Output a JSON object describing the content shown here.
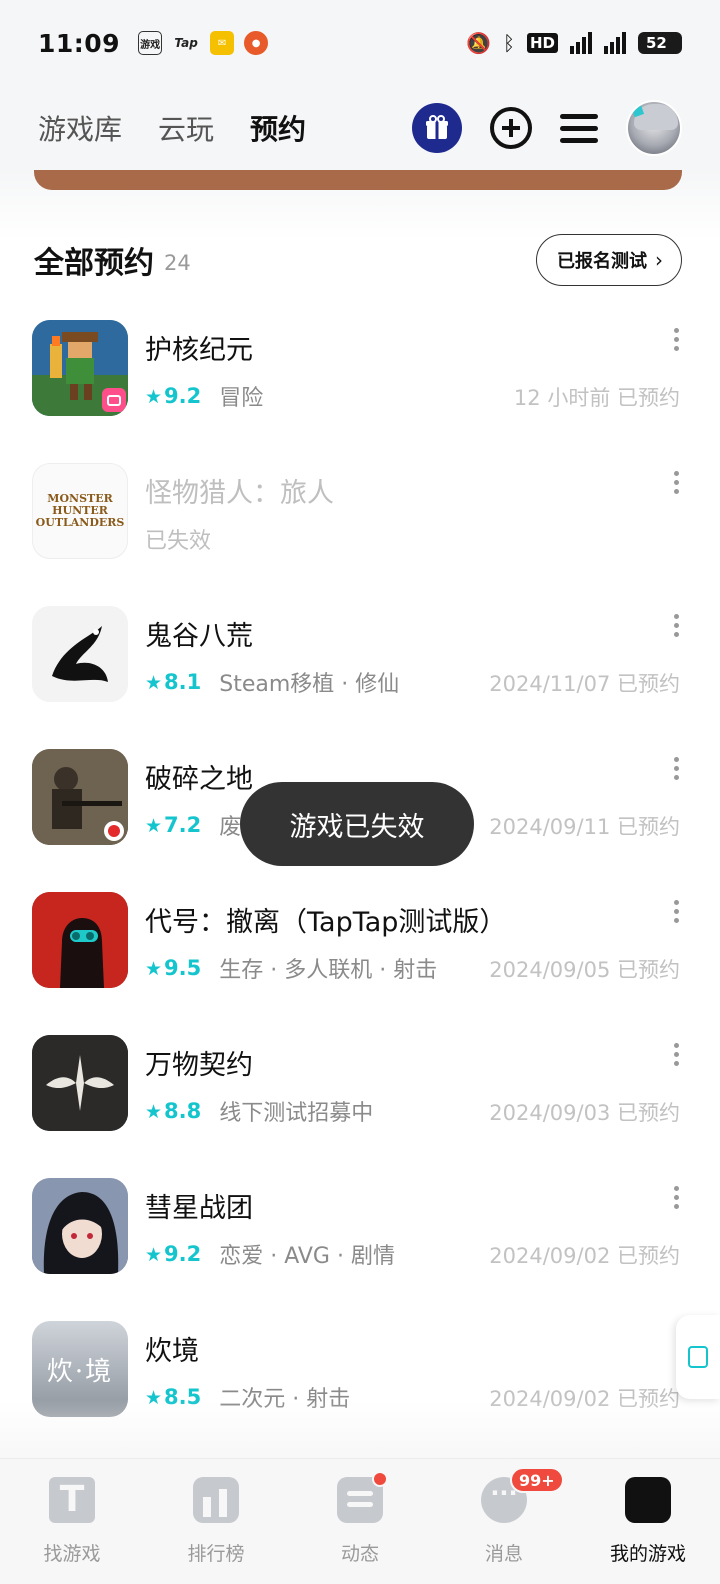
{
  "status_bar": {
    "time": "11:09",
    "app_icons": [
      "游戏大全",
      "Tap",
      "mail",
      "game"
    ],
    "network": "5G",
    "hd": "HD",
    "battery": "52"
  },
  "top_nav": {
    "tabs": [
      {
        "label": "游戏库",
        "active": false
      },
      {
        "label": "云玩",
        "active": false
      },
      {
        "label": "预约",
        "active": true
      }
    ],
    "accent_color": "#15c5ce",
    "icons": [
      "gift-icon",
      "add-circle-icon",
      "menu-icon",
      "avatar"
    ]
  },
  "section": {
    "title": "全部预约",
    "count": "24",
    "test_button_label": "已报名测试",
    "test_button_chevron": "›"
  },
  "games": [
    {
      "name": "护核纪元",
      "rating": "9.2",
      "tags": "冒险",
      "date": "12 小时前 已预约",
      "expired": false
    },
    {
      "name": "怪物猎人：旅人",
      "rating": "",
      "tags": "已失效",
      "date": "",
      "expired": true
    },
    {
      "name": "鬼谷八荒",
      "rating": "8.1",
      "tags": "Steam移植 · 修仙",
      "date": "2024/11/07 已预约",
      "expired": false
    },
    {
      "name": "破碎之地",
      "rating": "7.2",
      "tags": "废",
      "date": "2024/09/11 已预约",
      "expired": false
    },
    {
      "name": "代号：撤离（TapTap测试版）",
      "rating": "9.5",
      "tags": "生存 · 多人联机 · 射击",
      "date": "2024/09/05 已预约",
      "expired": false
    },
    {
      "name": "万物契约",
      "rating": "8.8",
      "tags": "线下测试招募中",
      "date": "2024/09/03 已预约",
      "expired": false
    },
    {
      "name": "彗星战团",
      "rating": "9.2",
      "tags": "恋爱 · AVG · 剧情",
      "date": "2024/09/02 已预约",
      "expired": false
    },
    {
      "name": "炊境",
      "rating": "8.5",
      "tags": "二次元 · 射击",
      "date": "2024/09/02 已预约",
      "expired": false
    }
  ],
  "icon_texts": {
    "monster_hunter": "MONSTER HUNTER OUTLANDERS",
    "chuijing": "炊·境"
  },
  "toast": "游戏已失效",
  "tab_bar": {
    "items": [
      {
        "label": "找游戏",
        "active": false
      },
      {
        "label": "排行榜",
        "active": false
      },
      {
        "label": "动态",
        "active": false
      },
      {
        "label": "消息",
        "active": false
      },
      {
        "label": "我的游戏",
        "active": true
      }
    ],
    "message_badge": "99+"
  }
}
